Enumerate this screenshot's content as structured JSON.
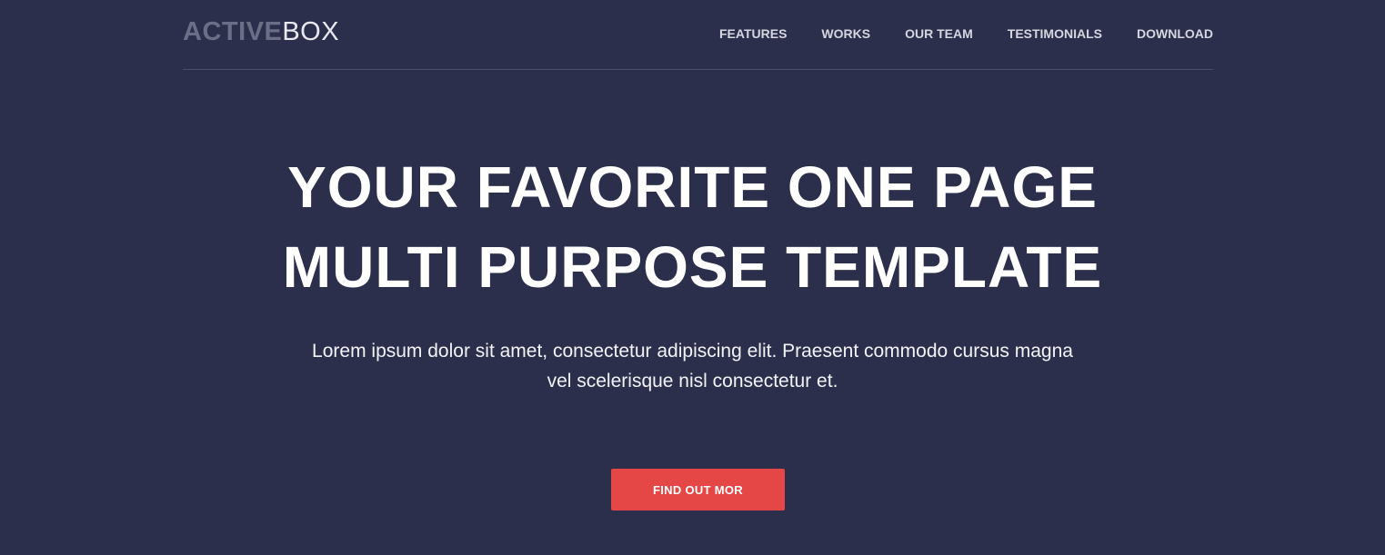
{
  "brand": {
    "logo_bold": "ACTIVE",
    "logo_light": "BOX"
  },
  "nav": {
    "items": [
      {
        "label": "FEATURES"
      },
      {
        "label": "WORKS"
      },
      {
        "label": "OUR TEAM"
      },
      {
        "label": "TESTIMONIALS"
      },
      {
        "label": "DOWNLOAD"
      }
    ]
  },
  "hero": {
    "title_line1": "YOUR FAVORITE ONE PAGE",
    "title_line2": "MULTI PURPOSE TEMPLATE",
    "subtitle_line1": "Lorem ipsum dolor sit amet, consectetur adipiscing elit. Praesent commodo cursus magna",
    "subtitle_line2": "vel scelerisque nisl consectetur et.",
    "cta_label": "FIND OUT MOR"
  },
  "colors": {
    "background": "#2c2f4b",
    "accent": "#e54646",
    "logo_bold": "#6b6e86",
    "nav_text": "#d5d6e0"
  }
}
